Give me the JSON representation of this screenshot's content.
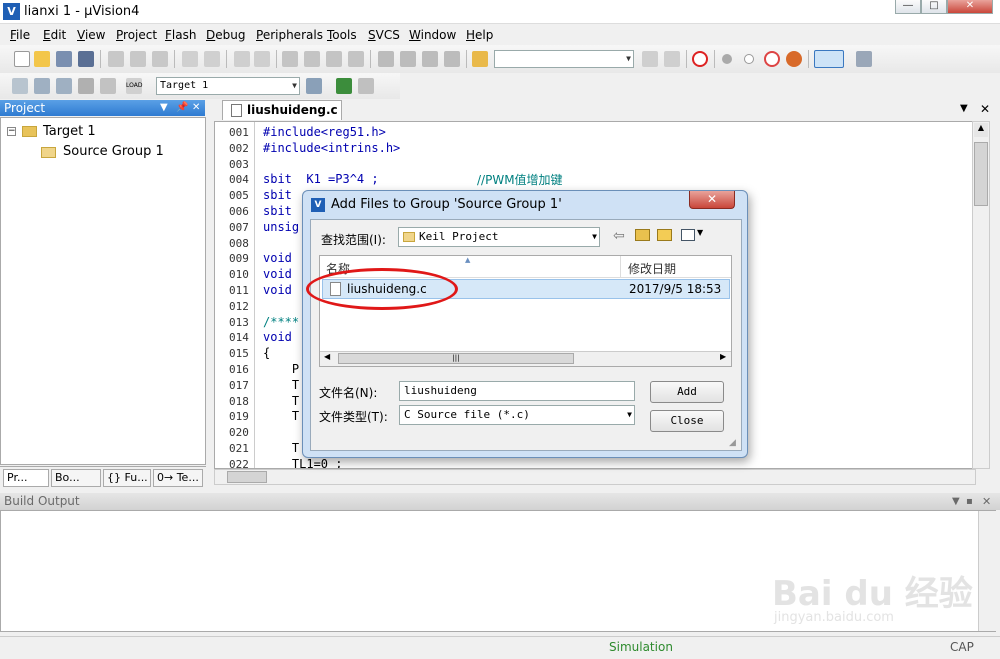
{
  "window": {
    "title": "lianxi 1 - µVision4"
  },
  "menu": [
    "File",
    "Edit",
    "View",
    "Project",
    "Flash",
    "Debug",
    "Peripherals",
    "Tools",
    "SVCS",
    "Window",
    "Help"
  ],
  "toolbar2": {
    "target_select": "Target 1"
  },
  "project_pane": {
    "title": "Project",
    "tree": {
      "root": "Target 1",
      "group": "Source Group 1"
    },
    "tabs": [
      "Pr...",
      "Bo...",
      "{} Fu...",
      "0→ Te..."
    ]
  },
  "editor": {
    "tab_label": "liushuideng.c",
    "lines": [
      {
        "n": "001",
        "t": "#include<reg51.h>"
      },
      {
        "n": "002",
        "t": "#include<intrins.h>"
      },
      {
        "n": "003",
        "t": ""
      },
      {
        "n": "004",
        "t": "sbit  K1 =P3^4 ;"
      },
      {
        "n": "005",
        "t": "sbit"
      },
      {
        "n": "006",
        "t": "sbit"
      },
      {
        "n": "007",
        "t": "unsig"
      },
      {
        "n": "008",
        "t": ""
      },
      {
        "n": "009",
        "t": "void"
      },
      {
        "n": "010",
        "t": "void"
      },
      {
        "n": "011",
        "t": "void"
      },
      {
        "n": "012",
        "t": ""
      },
      {
        "n": "013",
        "t": "/****"
      },
      {
        "n": "014",
        "t": "void"
      },
      {
        "n": "015",
        "t": "{"
      },
      {
        "n": "016",
        "t": "    P"
      },
      {
        "n": "017",
        "t": "    T"
      },
      {
        "n": "018",
        "t": "    T"
      },
      {
        "n": "019",
        "t": "    T"
      },
      {
        "n": "020",
        "t": ""
      },
      {
        "n": "021",
        "t": "    T"
      },
      {
        "n": "022",
        "t": "    TL1=0 ;"
      }
    ],
    "comment_line4": "//PWM值增加键"
  },
  "build_output": {
    "title": "Build Output"
  },
  "status": {
    "mode": "Simulation",
    "caps": "CAP"
  },
  "dialog": {
    "title": "Add Files to Group 'Source Group 1'",
    "look_in_label": "查找范围(I):",
    "look_in_value": "Keil Project",
    "col_name": "名称",
    "col_date": "修改日期",
    "files": [
      {
        "name": "liushuideng.c",
        "date": "2017/9/5 18:53"
      }
    ],
    "filename_label": "文件名(N):",
    "filename_value": "liushuideng",
    "filetype_label": "文件类型(T):",
    "filetype_value": "C Source file (*.c)",
    "add_label": "Add",
    "close_label": "Close"
  },
  "watermark": {
    "brand": "Bai du 经验",
    "url": "jingyan.baidu.com"
  }
}
